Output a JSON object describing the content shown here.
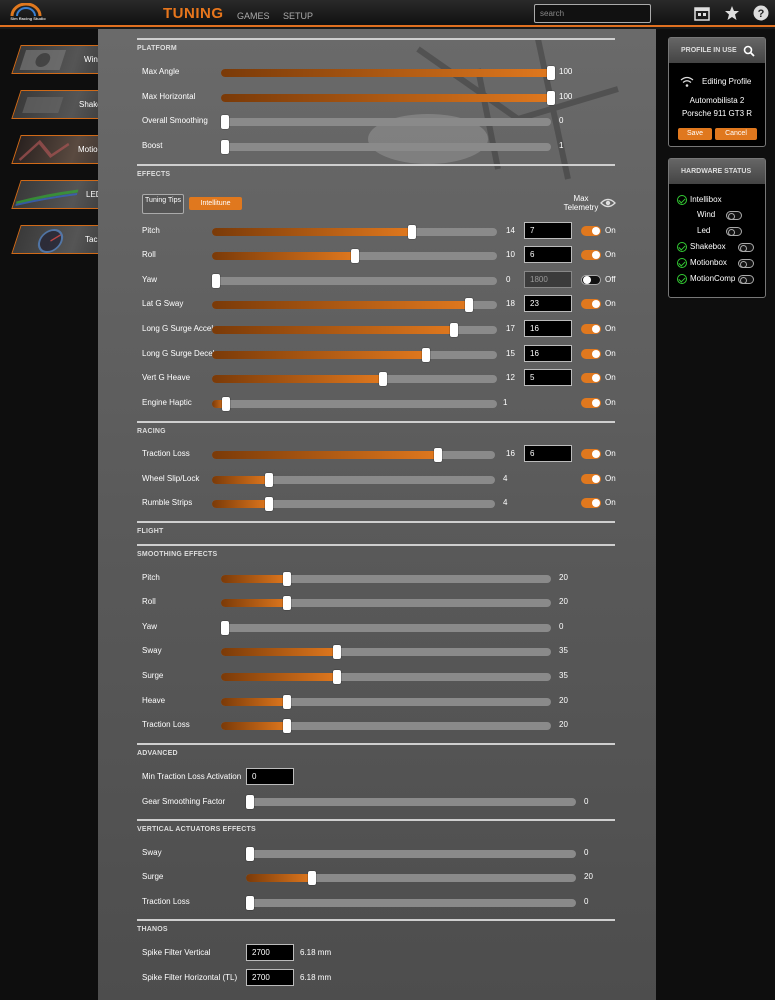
{
  "app": {
    "logo_text": "Sim Racing Studio"
  },
  "nav": {
    "tuning": "TUNING",
    "games": "GAMES",
    "setup": "SETUP"
  },
  "search": {
    "placeholder": "search"
  },
  "sidebar": {
    "items": [
      {
        "label": "Wind"
      },
      {
        "label": "Shake"
      },
      {
        "label": "Motion"
      },
      {
        "label": "LED"
      },
      {
        "label": "Tach"
      }
    ]
  },
  "platform": {
    "title": "PLATFORM",
    "rows": [
      {
        "label": "Max Angle",
        "value": "100",
        "fraction": 1.0
      },
      {
        "label": "Max Horizontal",
        "value": "100",
        "fraction": 1.0
      },
      {
        "label": "Overall Smoothing",
        "value": "0",
        "fraction": 0.0
      },
      {
        "label": "Boost",
        "value": "1",
        "fraction": 0.0
      }
    ]
  },
  "effects": {
    "title": "EFFECTS",
    "tips_label": "Tuning Tips",
    "intellitune_label": "Intellitune",
    "max_telemetry_label": "Max Telemetry",
    "rows": [
      {
        "label": "Pitch",
        "value": "14",
        "fraction": 0.7,
        "box": "7",
        "toggle": "On"
      },
      {
        "label": "Roll",
        "value": "10",
        "fraction": 0.5,
        "box": "6",
        "toggle": "On"
      },
      {
        "label": "Yaw",
        "value": "0",
        "fraction": 0.0,
        "box": "1800",
        "toggle": "Off"
      },
      {
        "label": "Lat G Sway",
        "value": "18",
        "fraction": 0.9,
        "box": "23",
        "toggle": "On"
      },
      {
        "label": "Long G Surge Accel",
        "value": "17",
        "fraction": 0.85,
        "box": "16",
        "toggle": "On"
      },
      {
        "label": "Long G Surge Decel",
        "value": "15",
        "fraction": 0.75,
        "box": "16",
        "toggle": "On"
      },
      {
        "label": "Vert G Heave",
        "value": "12",
        "fraction": 0.6,
        "box": "5",
        "toggle": "On"
      },
      {
        "label": "Engine Haptic",
        "value": "1",
        "fraction": 0.05,
        "box": "",
        "toggle": "On"
      }
    ]
  },
  "racing": {
    "title": "RACING",
    "rows": [
      {
        "label": "Traction Loss",
        "value": "16",
        "fraction": 0.8,
        "box": "6",
        "toggle": "On"
      },
      {
        "label": "Wheel Slip/Lock",
        "value": "4",
        "fraction": 0.2,
        "box": "",
        "toggle": "On"
      },
      {
        "label": "Rumble Strips",
        "value": "4",
        "fraction": 0.2,
        "box": "",
        "toggle": "On"
      }
    ]
  },
  "flight": {
    "title": "FLIGHT"
  },
  "smoothing": {
    "title": "SMOOTHING EFFECTS",
    "rows": [
      {
        "label": "Pitch",
        "value": "20",
        "fraction": 0.2
      },
      {
        "label": "Roll",
        "value": "20",
        "fraction": 0.2
      },
      {
        "label": "Yaw",
        "value": "0",
        "fraction": 0.0
      },
      {
        "label": "Sway",
        "value": "35",
        "fraction": 0.35
      },
      {
        "label": "Surge",
        "value": "35",
        "fraction": 0.35
      },
      {
        "label": "Heave",
        "value": "20",
        "fraction": 0.2
      },
      {
        "label": "Traction Loss",
        "value": "20",
        "fraction": 0.2
      }
    ]
  },
  "advanced": {
    "title": "ADVANCED",
    "min_traction_label": "Min Traction Loss Activation",
    "min_traction_value": "0",
    "gear_label": "Gear Smoothing Factor",
    "gear_value": "0",
    "gear_fraction": 0.0
  },
  "vertical": {
    "title": "VERTICAL ACTUATORS EFFECTS",
    "rows": [
      {
        "label": "Sway",
        "value": "0",
        "fraction": 0.0
      },
      {
        "label": "Surge",
        "value": "20",
        "fraction": 0.2
      },
      {
        "label": "Traction Loss",
        "value": "0",
        "fraction": 0.0
      }
    ]
  },
  "thanos": {
    "title": "THANOS",
    "rows": [
      {
        "label": "Spike Filter Vertical",
        "value": "2700",
        "mm": "6.18 mm"
      },
      {
        "label": "Spike Filter Horizontal (TL)",
        "value": "2700",
        "mm": "6.18 mm"
      }
    ]
  },
  "profile": {
    "title": "PROFILE IN USE",
    "editing": "Editing Profile",
    "game": "Automobilista 2",
    "car": "Porsche 911 GT3 R",
    "save": "Save",
    "cancel": "Cancel"
  },
  "hardware": {
    "title": "HARDWARE STATUS",
    "items": [
      {
        "label": "Intellibox",
        "check": true,
        "toggle": false
      },
      {
        "label": "Wind",
        "check": false,
        "toggle": true
      },
      {
        "label": "Led",
        "check": false,
        "toggle": true
      },
      {
        "label": "Shakebox",
        "check": true,
        "toggle": true
      },
      {
        "label": "Motionbox",
        "check": true,
        "toggle": true
      },
      {
        "label": "MotionComp",
        "check": true,
        "toggle": true
      }
    ]
  },
  "colors": {
    "accent": "#e0781e",
    "track": "#8a8a8a",
    "panel": "#5e5e5e"
  }
}
